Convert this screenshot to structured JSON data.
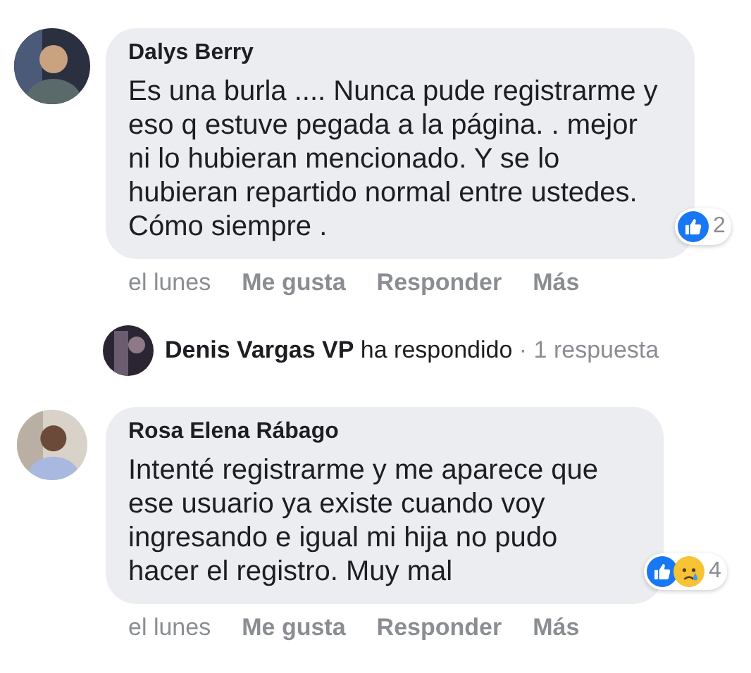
{
  "thread": [
    {
      "kind": "comment",
      "avatar": {
        "kind": "picture"
      },
      "author": "Dalys Berry",
      "text": "Es una burla .... Nunca pude registrarme y eso q estuve pegada a la página. . mejor ni lo hubieran mencionado. Y se lo hubieran repartido normal entre ustedes. Cómo siempre .",
      "reactions": [
        {
          "kind": "like"
        }
      ],
      "reaction_count": "2",
      "time": "el lunes",
      "actions": [
        "Me gusta",
        "Responder",
        "Más"
      ]
    },
    {
      "kind": "replies",
      "avatar": {
        "kind": "picture"
      },
      "author": "Denis Vargas VP",
      "verb": "ha respondido",
      "count": "· 1 respuesta"
    },
    {
      "kind": "comment",
      "avatar": {
        "kind": "picture"
      },
      "author": "Rosa Elena Rábago",
      "text": "Intenté registrarme y me aparece que ese usuario ya existe cuando voy ingresando e igual mi hija no pudo hacer el registro. Muy mal",
      "reactions": [
        {
          "kind": "like"
        },
        {
          "kind": "sad"
        }
      ],
      "reaction_count": "4",
      "time": "el lunes",
      "actions": [
        "Me gusta",
        "Responder",
        "Más"
      ]
    }
  ]
}
